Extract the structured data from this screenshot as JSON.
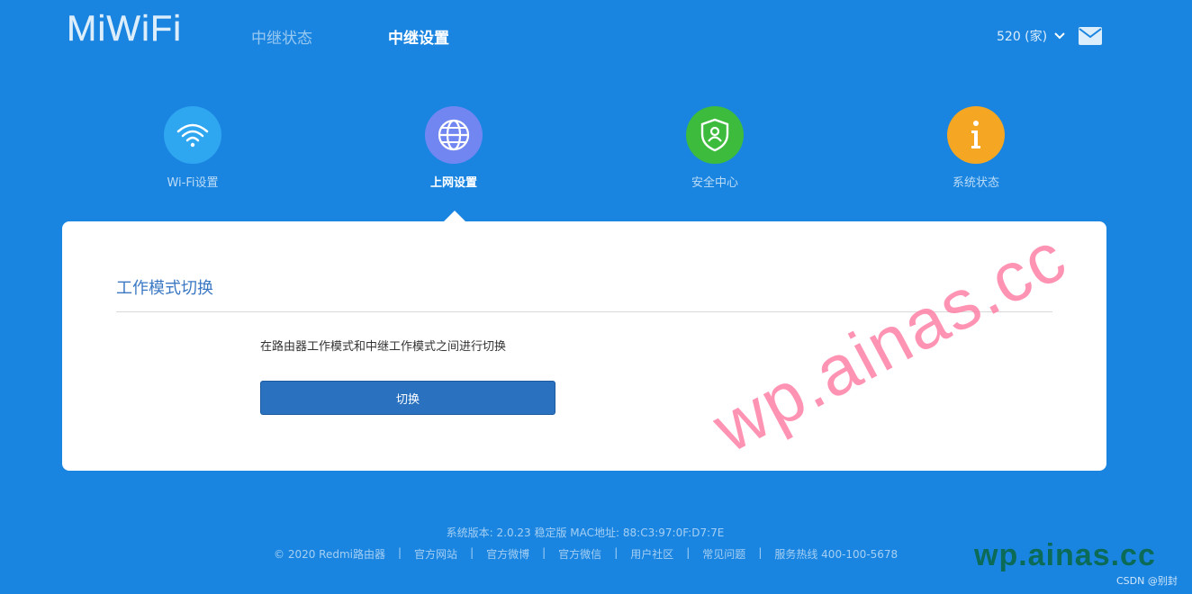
{
  "header": {
    "logo": "MiWiFi",
    "nav": [
      "中继状态",
      "中继设置"
    ],
    "device": "520 (家)"
  },
  "tiles": [
    {
      "label": "Wi-Fi设置",
      "icon": "wifi-icon",
      "color": "#2fa6f0"
    },
    {
      "label": "上网设置",
      "icon": "globe-icon",
      "color": "#7286f2"
    },
    {
      "label": "安全中心",
      "icon": "shield-user-icon",
      "color": "#3dbb3d"
    },
    {
      "label": "系统状态",
      "icon": "info-icon",
      "color": "#f5a623"
    }
  ],
  "card": {
    "title": "工作模式切换",
    "description": "在路由器工作模式和中继工作模式之间进行切换",
    "button": "切换"
  },
  "footer": {
    "version": "系统版本: 2.0.23 稳定版   MAC地址: 88:C3:97:0F:D7:7E",
    "copyright": "© 2020 Redmi路由器",
    "links": [
      "官方网站",
      "官方微博",
      "官方微信",
      "用户社区",
      "常见问题",
      "服务热线 400-100-5678"
    ]
  },
  "watermarks": {
    "diagonal": "wp.ainas.cc",
    "corner": "wp.ainas.cc",
    "csdn": "CSDN @别封"
  },
  "colors": {
    "background": "#1a85e0",
    "card": "#ffffff",
    "button": "#2a72c0",
    "title": "#3a78c3"
  }
}
